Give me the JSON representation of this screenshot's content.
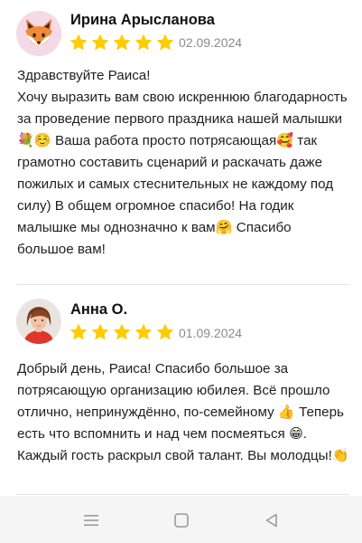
{
  "reviews": [
    {
      "author": "Ирина Арысланова",
      "avatar_icon": "fox-emoji-avatar",
      "rating": 5,
      "date": "02.09.2024",
      "text": "Здравствуйте Раиса!\nХочу выразить вам свою искреннюю благодарность за проведение первого праздника нашей малышки💐☺️ Ваша работа просто потрясающая🥰 так грамотно составить сценарий и раскачать даже пожилых и самых стеснительных не каждому под силу) В общем огромное спасибо! На годик малышке мы однозначно к вам🤗 Спасибо большое вам!"
    },
    {
      "author": "Анна О.",
      "avatar_icon": "user-photo-avatar",
      "rating": 5,
      "date": "01.09.2024",
      "text": "Добрый день, Раиса! Спасибо большое за потрясающую организацию юбилея. Всё прошло отлично, непринуждённо, по-семейному 👍 Теперь есть что вспомнить и над чем посмеяться 😁. Каждый гость раскрыл свой талант. Вы молодцы!👏"
    }
  ],
  "colors": {
    "star": "#ffcc00",
    "date": "#8c8c8c",
    "divider": "#e3e3e3",
    "navbar": "#f5f5f5",
    "nav_icon": "#9a9a9a"
  },
  "navbar": {
    "icons": [
      "menu-icon",
      "home-icon",
      "back-icon"
    ]
  }
}
